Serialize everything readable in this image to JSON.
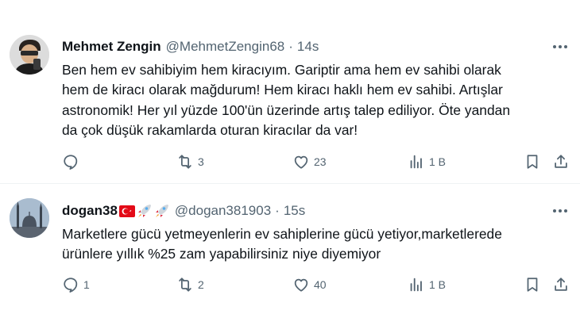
{
  "tweets": [
    {
      "name": "Mehmet Zengin",
      "handle": "@MehmetZengin68",
      "dot": "·",
      "time": "14s",
      "text_lines": [
        "Ben hem ev sahibiyim hem kiracıyım. Gariptir ama hem ev sahibi olarak",
        "hem de kiracı olarak mağdurum! Hem kiracı haklı hem ev sahibi. Artışlar",
        "astronomik! Her yıl yüzde 100'ün üzerinde artış talep ediliyor. Öte yandan",
        "da çok düşük rakamlarda oturan kiracılar da var!"
      ],
      "reply_count": "",
      "retweet_count": "3",
      "like_count": "23",
      "view_count": "1 B"
    },
    {
      "name": "dogan38",
      "name_emoji": "🇹🇷 🚀 🚀",
      "handle": "@dogan381903",
      "dot": "·",
      "time": "15s",
      "text_lines": [
        "Marketlere gücü yetmeyenlerin ev sahiplerine gücü yetiyor,marketlerede",
        "ürünlere yıllık %25 zam yapabilirsiniz niye diyemiyor"
      ],
      "reply_count": "1",
      "retweet_count": "2",
      "like_count": "40",
      "view_count": "1 B"
    }
  ],
  "icons": {
    "reply": "reply-bubble-icon",
    "retweet": "retweet-icon",
    "like": "heart-icon",
    "views": "bar-chart-icon",
    "bookmark": "bookmark-icon",
    "share": "share-upload-icon",
    "more": "more-dots-icon"
  },
  "colors": {
    "text": "#0f1419",
    "secondary": "#536471",
    "divider": "#eff3f4",
    "flag_red": "#e30a17"
  }
}
